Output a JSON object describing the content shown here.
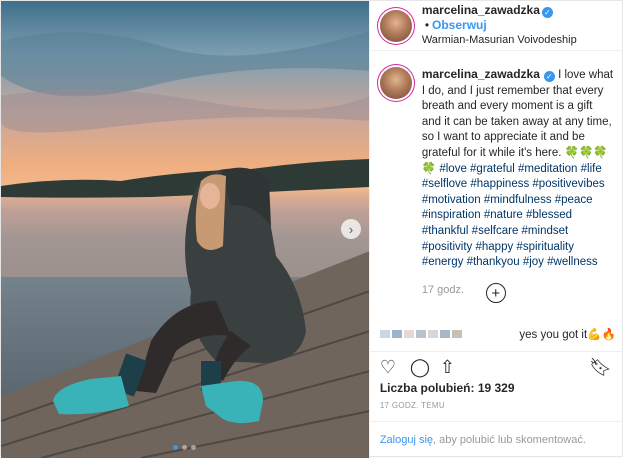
{
  "header": {
    "username": "marcelina_zawadzka",
    "separator": "•",
    "follow_label": "Obserwuj",
    "location": "Warmian-Masurian Voivodeship"
  },
  "caption": {
    "username": "marcelina_zawadzka",
    "text": "I love what I do, and I just remember that every breath and every moment is a gift and it can be taken away at any time, so I want to appreciate it and be grateful for it while it's here.",
    "emoji": "🍀🍀🍀🍀",
    "hashtags": "#love #grateful #meditation #life #selflove #happiness #positivevibes #motivation #mindfulness #peace #inspiration #nature #blessed #thankful #selfcare #mindset #positivity #happy #spirituality #energy #thankyou #joy #wellness",
    "time": "17 godz."
  },
  "add_comment_icon": "plus-circle-icon",
  "comment": {
    "text": "yes you got it",
    "emoji": "💪🔥"
  },
  "actions": {
    "icons": [
      "heart-icon",
      "comment-icon",
      "share-icon",
      "bookmark-icon"
    ]
  },
  "likes": {
    "label": "Liczba polubień:",
    "count": "19 329"
  },
  "posted_ago": "17 GODZ. TEMU",
  "login": {
    "link": "Zaloguj się",
    "text": ", aby polubić lub skomentować."
  },
  "carousel": {
    "slides": 3,
    "active": 0,
    "next_icon": "chevron-right-icon"
  },
  "colors": {
    "link": "#3897f0",
    "hashtag": "#003569",
    "muted": "#999999"
  }
}
